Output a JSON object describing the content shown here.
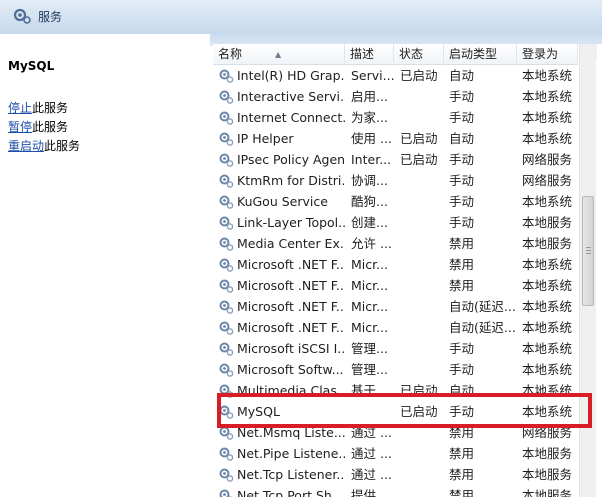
{
  "window": {
    "title": "服务"
  },
  "left_panel": {
    "service_name": "MySQL",
    "actions": [
      {
        "link": "停止",
        "suffix": "此服务"
      },
      {
        "link": "暂停",
        "suffix": "此服务"
      },
      {
        "link": "重启动",
        "suffix": "此服务"
      }
    ]
  },
  "table": {
    "columns": [
      "名称",
      "描述",
      "状态",
      "启动类型",
      "登录为"
    ],
    "rows": [
      {
        "name": "Intel(R) HD Grap...",
        "desc": "Servi...",
        "status": "已启动",
        "startup": "自动",
        "logon": "本地系统"
      },
      {
        "name": "Interactive Servi...",
        "desc": "启用...",
        "status": "",
        "startup": "手动",
        "logon": "本地系统"
      },
      {
        "name": "Internet Connect...",
        "desc": "为家...",
        "status": "",
        "startup": "手动",
        "logon": "本地系统"
      },
      {
        "name": "IP Helper",
        "desc": "使用 ...",
        "status": "已启动",
        "startup": "自动",
        "logon": "本地系统"
      },
      {
        "name": "IPsec Policy Agent",
        "desc": "Inter...",
        "status": "已启动",
        "startup": "手动",
        "logon": "网络服务"
      },
      {
        "name": "KtmRm for Distri...",
        "desc": "协调...",
        "status": "",
        "startup": "手动",
        "logon": "网络服务"
      },
      {
        "name": "KuGou Service",
        "desc": "酷狗...",
        "status": "",
        "startup": "手动",
        "logon": "本地系统"
      },
      {
        "name": "Link-Layer Topol...",
        "desc": "创建...",
        "status": "",
        "startup": "手动",
        "logon": "本地服务"
      },
      {
        "name": "Media Center Ex...",
        "desc": "允许 ...",
        "status": "",
        "startup": "禁用",
        "logon": "本地服务"
      },
      {
        "name": "Microsoft .NET F...",
        "desc": "Micr...",
        "status": "",
        "startup": "禁用",
        "logon": "本地系统"
      },
      {
        "name": "Microsoft .NET F...",
        "desc": "Micr...",
        "status": "",
        "startup": "禁用",
        "logon": "本地系统"
      },
      {
        "name": "Microsoft .NET F...",
        "desc": "Micr...",
        "status": "",
        "startup": "自动(延迟...",
        "logon": "本地系统"
      },
      {
        "name": "Microsoft .NET F...",
        "desc": "Micr...",
        "status": "",
        "startup": "自动(延迟...",
        "logon": "本地系统"
      },
      {
        "name": "Microsoft iSCSI I...",
        "desc": "管理...",
        "status": "",
        "startup": "手动",
        "logon": "本地系统"
      },
      {
        "name": "Microsoft Softw...",
        "desc": "管理...",
        "status": "",
        "startup": "手动",
        "logon": "本地系统"
      },
      {
        "name": "Multimedia Clas...",
        "desc": "基于...",
        "status": "已启动",
        "startup": "自动",
        "logon": "本地系统"
      },
      {
        "name": "MySQL",
        "desc": "",
        "status": "已启动",
        "startup": "手动",
        "logon": "本地系统"
      },
      {
        "name": "Net.Msmq Liste...",
        "desc": "通过 ...",
        "status": "",
        "startup": "禁用",
        "logon": "网络服务"
      },
      {
        "name": "Net.Pipe Listene...",
        "desc": "通过 ...",
        "status": "",
        "startup": "禁用",
        "logon": "本地服务"
      },
      {
        "name": "Net.Tcp Listener...",
        "desc": "通过 ...",
        "status": "",
        "startup": "禁用",
        "logon": "本地服务"
      },
      {
        "name": "Net.Tcp Port Sh...",
        "desc": "提供 ...",
        "status": "",
        "startup": "禁用",
        "logon": "本地服务"
      }
    ]
  },
  "colors": {
    "highlight": "#d81d24",
    "link": "#1c4fa8",
    "header_bg": "#c6d8ec"
  },
  "icons": {
    "window": "services-gear-icon",
    "row": "service-gear-icon"
  }
}
